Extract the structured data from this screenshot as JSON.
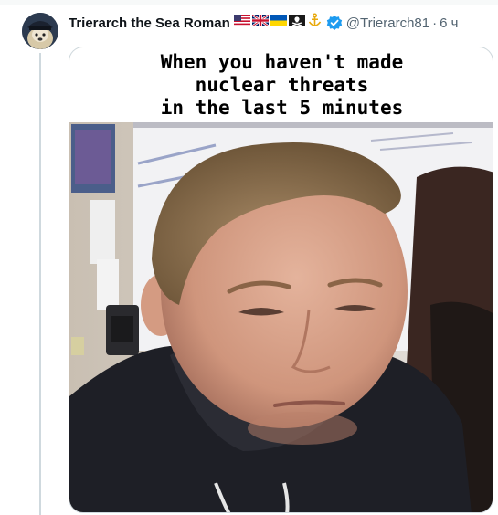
{
  "tweet": {
    "display_name": "Trierarch the Sea Roman",
    "handle": "@Trierarch81",
    "separator": "·",
    "time": "6 ч",
    "flag_icons": [
      "us-flag-icon",
      "uk-flag-icon",
      "ukraine-flag-icon",
      "pirate-flag-icon",
      "anchor-emblem-icon"
    ],
    "verified_icon": "verified-badge-icon",
    "accent_color": "#1d9bf0"
  },
  "meme": {
    "caption_lines": [
      "When you haven't made",
      "nuclear threats",
      "in the last 5 minutes"
    ]
  }
}
